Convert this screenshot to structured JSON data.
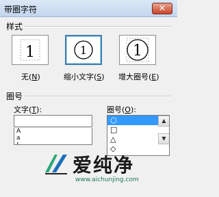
{
  "window": {
    "title": "带圈字符",
    "close_glyph": "✕"
  },
  "style_group": {
    "label": "样式",
    "options": [
      {
        "preview_char": "1",
        "caption": "无",
        "key": "N",
        "selected": false,
        "border_style": "dashed-square"
      },
      {
        "preview_char": "1",
        "caption": "缩小文字",
        "key": "S",
        "selected": true,
        "border_style": "circle"
      },
      {
        "preview_char": "1",
        "caption": "增大圈号",
        "key": "E",
        "selected": false,
        "border_style": "large-circle"
      }
    ]
  },
  "enclosure_group": {
    "label": "圈号",
    "text_label": "文字(",
    "text_key": "T",
    "text_label_end": "):",
    "text_input_value": "",
    "text_list": [
      "A",
      "a",
      "!",
      "1"
    ],
    "symbol_label": "圈号(",
    "symbol_key": "O",
    "symbol_label_end": "):",
    "symbols": [
      "○",
      "□",
      "△",
      "◇"
    ],
    "selected_symbol_index": 0
  },
  "watermark": {
    "name": "爱纯净",
    "url": "www.aichunjing.com"
  },
  "colors": {
    "selection": "#3399ff",
    "selected_border": "#3c7fb1",
    "close_red": "#c84328"
  }
}
